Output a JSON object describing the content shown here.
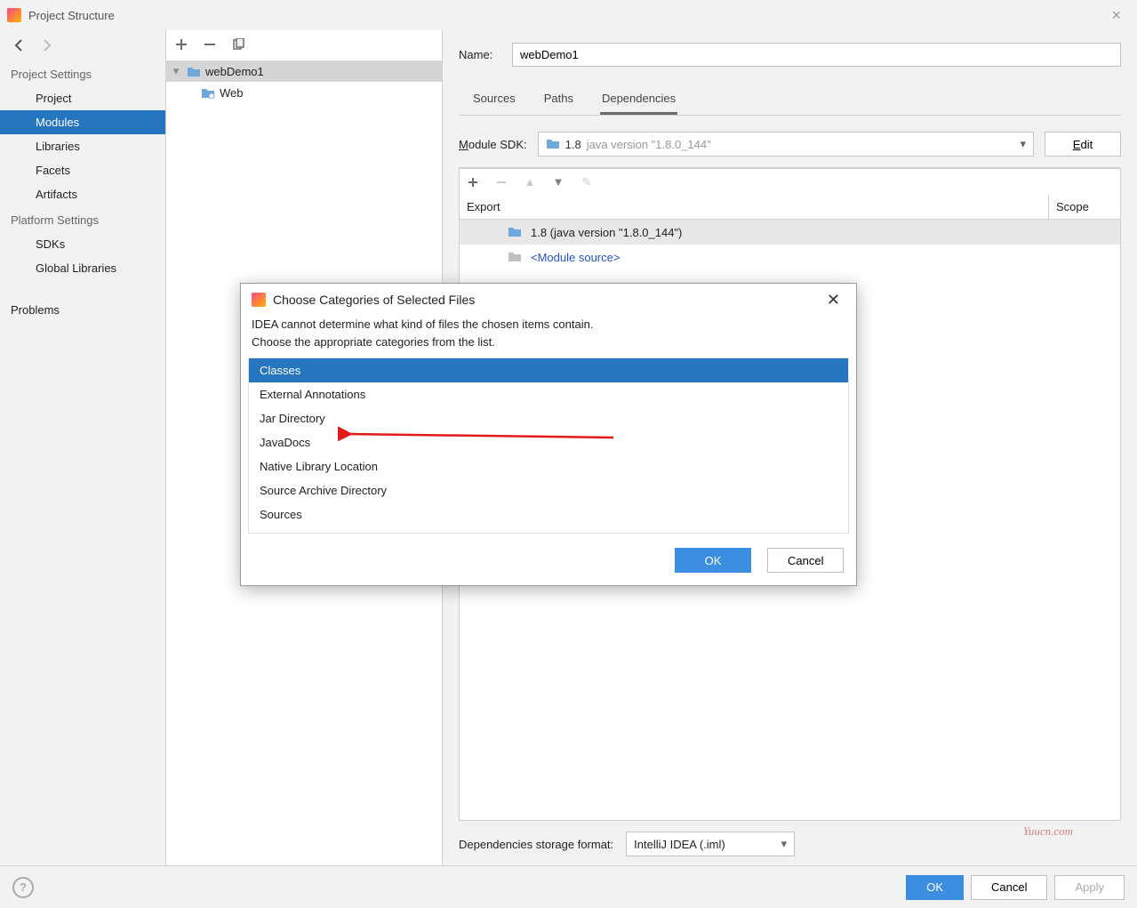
{
  "window": {
    "title": "Project Structure"
  },
  "sidebar": {
    "section1_title": "Project Settings",
    "items1": [
      "Project",
      "Modules",
      "Libraries",
      "Facets",
      "Artifacts"
    ],
    "section2_title": "Platform Settings",
    "items2": [
      "SDKs",
      "Global Libraries"
    ],
    "problems": "Problems"
  },
  "tree": {
    "root": "webDemo1",
    "child": "Web"
  },
  "main": {
    "name_label": "Name:",
    "name_value": "webDemo1",
    "tabs": [
      "Sources",
      "Paths",
      "Dependencies"
    ],
    "module_sdk_label": "Module SDK:",
    "sdk_name": "1.8",
    "sdk_version": "java version \"1.8.0_144\"",
    "edit_label": "Edit",
    "dep_cols": {
      "export": "Export",
      "scope": "Scope"
    },
    "dep_rows": [
      "1.8 (java version \"1.8.0_144\")",
      "<Module source>"
    ],
    "dep_storage_label": "Dependencies storage format:",
    "dep_storage_value": "IntelliJ IDEA (.iml)"
  },
  "buttons": {
    "ok": "OK",
    "cancel": "Cancel",
    "apply": "Apply"
  },
  "modal": {
    "title": "Choose Categories of Selected Files",
    "msg1": "IDEA cannot determine what kind of files the chosen items contain.",
    "msg2": "Choose the appropriate categories from the list.",
    "items": [
      "Classes",
      "External Annotations",
      "Jar Directory",
      "JavaDocs",
      "Native Library Location",
      "Source Archive Directory",
      "Sources"
    ],
    "ok": "OK",
    "cancel": "Cancel"
  },
  "watermark": "Yuucn.com"
}
